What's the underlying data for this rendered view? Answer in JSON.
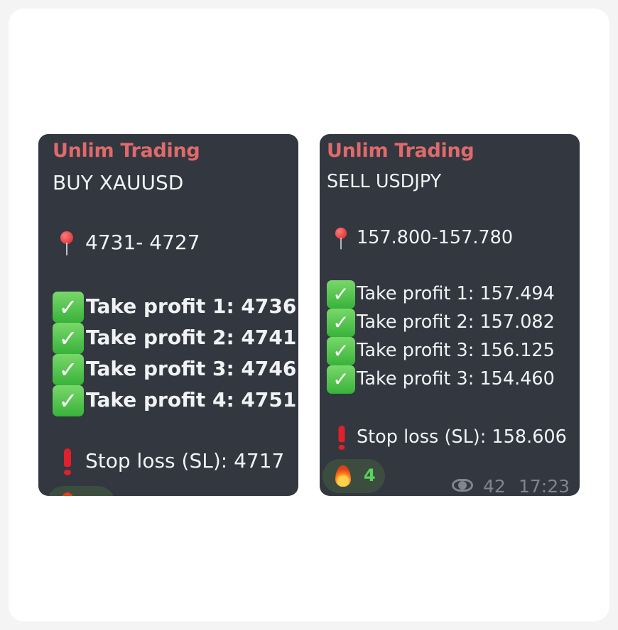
{
  "colors": {
    "card_bg": "#323740",
    "sender": "#e06a6a",
    "text": "#f1f2f4",
    "reaction_count": "#5ad35a",
    "meta": "#7f8690"
  },
  "messages": [
    {
      "sender": "Unlim Trading",
      "signal": "BUY XAUUSD",
      "entry_icon": "pushpin-icon",
      "entry": "4731- 4727",
      "take_profits": [
        "Take profit 1: 4736",
        "Take profit 2: 4741",
        "Take profit 3: 4746",
        "Take profit 4: 4751"
      ],
      "stop_loss_icon": "exclamation-icon",
      "stop_loss": "Stop loss (SL): 4717"
    },
    {
      "sender": "Unlim Trading",
      "signal": "SELL USDJPY",
      "entry_icon": "pushpin-icon",
      "entry": "157.800-157.780",
      "take_profits": [
        "Take profit 1: 157.494",
        "Take profit 2: 157.082",
        "Take profit 3: 156.125",
        "Take profit 3: 154.460"
      ],
      "stop_loss_icon": "exclamation-icon",
      "stop_loss": "Stop loss (SL): 158.606",
      "reaction": {
        "icon": "fire-icon",
        "count": "4"
      },
      "views": "42",
      "time": "17:23"
    }
  ]
}
